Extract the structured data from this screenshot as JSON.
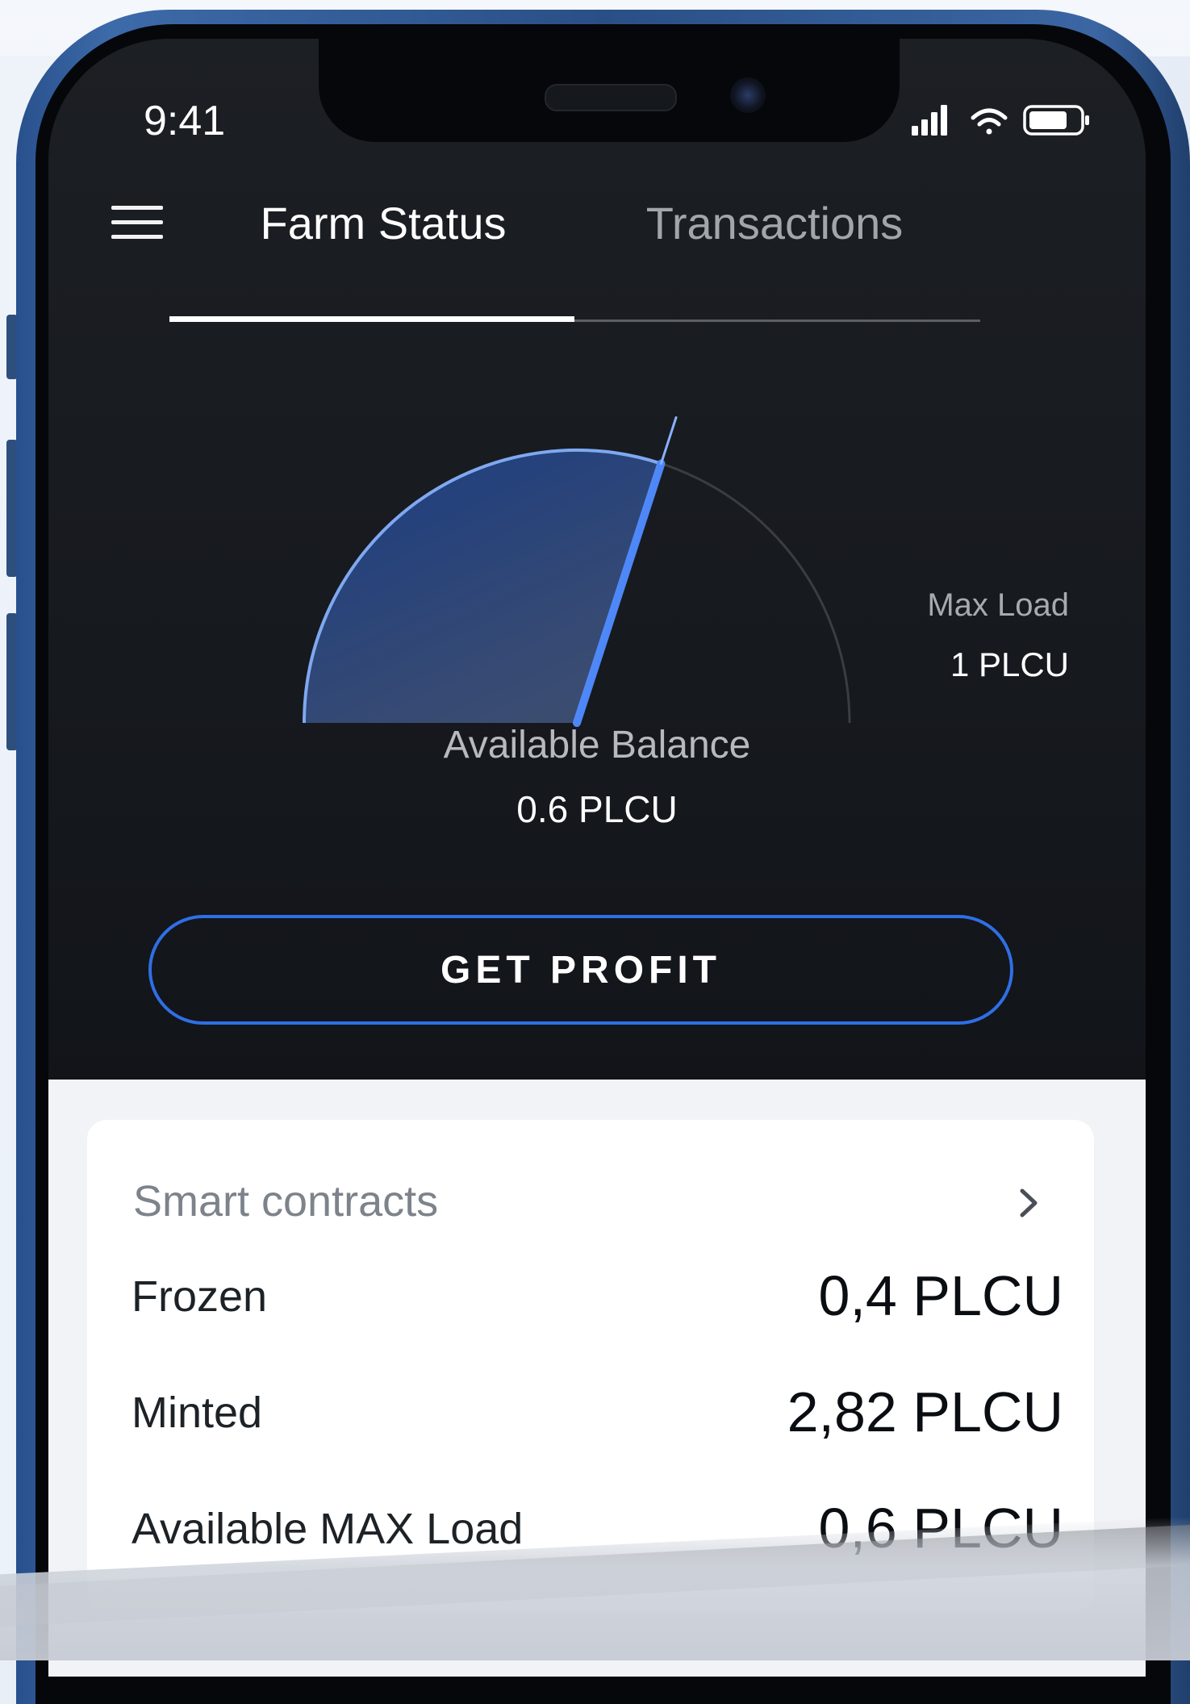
{
  "status_bar": {
    "time": "9:41",
    "icons": [
      "cellular-signal-icon",
      "wifi-icon",
      "battery-icon"
    ]
  },
  "nav": {
    "menu_icon": "hamburger-menu-icon",
    "tabs": [
      {
        "label": "Farm Status",
        "active": true
      },
      {
        "label": "Transactions",
        "active": false
      }
    ]
  },
  "gauge": {
    "fill_fraction": 0.6,
    "max_label": "Max Load",
    "max_value": "1 PLCU",
    "balance_label": "Available Balance",
    "balance_value": "0.6 PLCU"
  },
  "actions": {
    "get_profit_label": "GET PROFIT"
  },
  "smart_contracts": {
    "title": "Smart contracts",
    "chevron_icon": "chevron-right-icon",
    "rows": [
      {
        "label": "Frozen",
        "value": "0,4 PLCU"
      },
      {
        "label": "Minted",
        "value": "2,82 PLCU"
      },
      {
        "label": "Available MAX Load",
        "value": "0,6 PLCU"
      }
    ]
  },
  "colors": {
    "accent": "#2f6fe6",
    "screen_bg": "#16191e",
    "card_bg": "#ffffff",
    "frame": "#2c5490"
  }
}
